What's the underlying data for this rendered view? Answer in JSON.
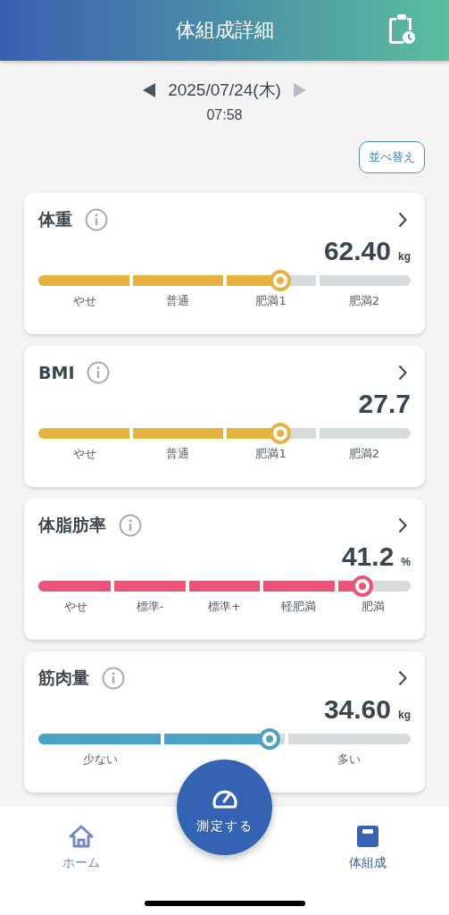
{
  "header": {
    "title": "体組成詳細"
  },
  "date_nav": {
    "date": "2025/07/24(木)",
    "time": "07:58",
    "prev_disabled": false,
    "next_disabled": true
  },
  "sort_button": "並べ替え",
  "cards": [
    {
      "title": "体重",
      "value": "62.40",
      "unit": "kg",
      "color": "#e6b33f",
      "level": 0.65,
      "segments": [
        {
          "label": "やせ"
        },
        {
          "label": "普通"
        },
        {
          "label": "肥満1"
        },
        {
          "label": "肥満2"
        }
      ]
    },
    {
      "title": "BMI",
      "value": "27.7",
      "color": "#e6b33f",
      "level": 0.65,
      "segments": [
        {
          "label": "やせ"
        },
        {
          "label": "普通"
        },
        {
          "label": "肥満1"
        },
        {
          "label": "肥満2"
        }
      ]
    },
    {
      "title": "体脂肪率",
      "value": "41.2",
      "unit": "%",
      "color": "#e85577",
      "level": 0.87,
      "segments": [
        {
          "label": "やせ"
        },
        {
          "label": "標準-"
        },
        {
          "label": "標準+"
        },
        {
          "label": "軽肥満"
        },
        {
          "label": "肥満"
        }
      ]
    },
    {
      "title": "筋肉量",
      "value": "34.60",
      "unit": "kg",
      "color": "#4aa0c8",
      "level": 0.62,
      "segments": [
        {
          "kind": "labeled",
          "label": "少ない"
        },
        {
          "kind": "blank"
        },
        {
          "kind": "labeled",
          "label": "多い"
        }
      ]
    }
  ],
  "measure_button": "測定する",
  "tabs": [
    {
      "label": "ホーム",
      "kind": "home",
      "selected": false
    },
    {
      "label": "体組成",
      "kind": "scale",
      "selected": true
    }
  ]
}
